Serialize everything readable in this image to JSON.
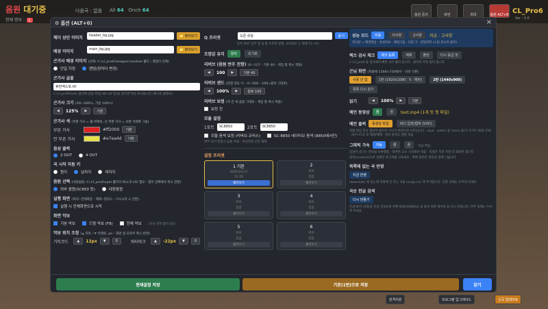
{
  "topbar": {
    "song_prefix": "음원",
    "song_suffix": "대기중",
    "flat_label": "다음곡 : 없음",
    "all_label": "All",
    "all_count": "64",
    "onch_label": "Onch",
    "onch_count": "64",
    "row2_label": "현재 명보 :",
    "row2_badge": "L",
    "btn1": "음원 중지",
    "btn2": "화면 CTRL+L",
    "btn3": "최대 CTRL+B",
    "btn4": "음원 ALT+B",
    "brand": "CL_Pro6",
    "version": "Ver : 0.6"
  },
  "dialog": {
    "title": "⚙ 옵션 (ALT+0)",
    "close": "×"
  },
  "col1": {
    "header_img_label": "헤더 상단 이미지",
    "header_img_value": "header_bg.jpg",
    "browse": "📁 찾아보기",
    "bg_img_label": "배경 이미지",
    "bg_img_value": "main_bg.jpg",
    "lyrics_bg_label": "곤가사 배경 이미지",
    "lyrics_bg_sub": "(선택: C:\\cl_pro6\\images\\random 폴더 : 랜덤이 안돼)",
    "radio_single": "단일 지정",
    "radio_random": "랜덤(장마다 변경)",
    "font_label": "곤가사 글꼴",
    "font_value": "휴먼엑스포.ttf",
    "font_sub": "C:\\cl_pro6\\fonts 폴더에 글꼴 파일(.ttf/.otf 등)을 넣으면 자동 표시됩니다 (재시작 불필요)",
    "size_label": "곤가사 크기",
    "size_sub": "(50~300%, 기본 100%)",
    "size_value": "125%",
    "default": "기본",
    "color_label": "곤가사 색",
    "color_sub": "(부른 가사 = 줄 위쪽비, 안 부른 가사 = 오른 아래쪽 그음)",
    "sung_label": "부른 가사",
    "sung_hex": "#ff2000",
    "sung_color": "#e02020",
    "unsung_label": "안 부른 가사",
    "unsung_hex": "#e7ea4d",
    "unsung_color": "#e7e04d",
    "audio_label": "음성 출력",
    "out2": "2 OUT",
    "out4": "4 OUT",
    "voice_label": "곡 시작 자동 키",
    "v1": "원키",
    "v2": "남자키",
    "v3": "여자키",
    "sound_label": "음원 선택",
    "sound_sub": "(내장음원: C:\\cl_pro6\\sym 폴더의 DLL과 sf2 필요 · 합미 선택에서 즉시 전환)",
    "s1": "외부 음원(SC850 등)",
    "s2": "내장음원",
    "exec_label": "실행 화면",
    "exec_sub": "(최대~전체화면 · 해제~창모드 · 다시시작 시 전환)",
    "exec_chk": "실행 시 전체화면으로 시작",
    "scr_label": "화면 악보",
    "scr1": "기본 악보",
    "scr2": "드럼 악보 (F8)",
    "scr3": "전체 악보",
    "scr3_sub": "(가사 영역 없이 4단)",
    "offset_label": "악보 위치 조정",
    "offset_sub": "(▲ 위로 / ▼ 아래로, px · 화면 원 오로부 즉시 반영)",
    "guitar_label": "기타코드",
    "guitar_val": "12px",
    "guitar_reset": "0",
    "water_label": "워터마크",
    "water_val": "-22px",
    "water_reset": "0"
  },
  "col2": {
    "q_label": "Q 프리셋",
    "q_value": "오픈 쉬웠",
    "q_btn": "듣기",
    "q_sub": "동주 OVT 옷무 중 Q 를 누르면 실행. A/S/D/F 는 발매 F1~F4",
    "mic_label": "조명감 유지",
    "mic_on": "유지",
    "mic_off": "초기화",
    "reverb_label": "리버브 (음원 반주 잔향)",
    "reverb_sub": "(0~127 · 기본 40 · 게임 중 즉시 적용)",
    "reverb_val": "100",
    "reverb_def": "기본 40",
    "send_label": "리버브 센드",
    "send_sub": "(잔향 강도 % · 0~200 · 100=원로 그대로)",
    "send_val": "100%",
    "send_def": "원로 100",
    "boost_label": "리버브 보정",
    "boost_sub": "(하 전 세 음원 그대로 · 게임 중 즉시 적용)",
    "boost_chk": "보정 전",
    "module_label": "모듈 설정",
    "port1": "1포트",
    "port1_val": "SC8850",
    "port2": "2포트",
    "port2_val": "SC8850",
    "mod_chk1": "모듈 음색 보정 (리버브·코러스)",
    "mod_chk2": "SC-8850 네이티브 음색 (8850에서만)",
    "mod_sub": "외부 악기 연결시 음원 특화 · 이상하면 곤한 해제",
    "preset_header": "설정 프리셋",
    "presets": [
      {
        "n": "1 기본",
        "d": "2026-03-17",
        "d2": "11:28",
        "lb": "불러오기"
      },
      {
        "n": "2",
        "d": "비어",
        "d2": "있음",
        "lb": "불러오기"
      },
      {
        "n": "3",
        "d": "비어",
        "d2": "있음",
        "lb": "불러오기"
      },
      {
        "n": "4",
        "d": "비어",
        "d2": "있음",
        "lb": "불러오기"
      },
      {
        "n": "5",
        "d": "비어",
        "d2": "있음",
        "lb": "불러오기"
      },
      {
        "n": "6",
        "d": "비어",
        "d2": "있음",
        "lb": "불러오기"
      }
    ]
  },
  "col3": {
    "perf_label": "성능 모드",
    "perf_opts": [
      "자동",
      "저사양",
      "고사양"
    ],
    "perf_cur": "지금 : 고사양",
    "perf_sub": "저사양 = 배경영상 · 손실악보 · 배점그림 · 인원 그 · 잔업까지 (스킵 콘소리 없이)",
    "album_label": "렉쓰 검사 체크",
    "album_opts": [
      "체크 등록",
      "예제",
      "폴린",
      "다시 등급 첫"
    ],
    "album_sub": "C:\\cl_pro6 을 검사해서 빠른 곡이 몰리 입니다 · 원리적 목적 없이 됩니다",
    "res_label": "곤님 화면",
    "res_sub": "(적용에 1280×720에서 · 이웃 다른)",
    "res_opts": [
      "사용 안 함",
      "1번 (1920x1080 · 5 · 해된)",
      "2번 (1440x900)"
    ],
    "res_reset": "목록 다시 읽기",
    "read_label": "읽기",
    "read_val": "100%",
    "read_def": "기본",
    "v_label": "예언 동영상",
    "v_opts": [
      "켬",
      "끔"
    ],
    "v_file": "text.mp4 (1개 등 첫 파일)",
    "p_label": "예언 출력",
    "p_opts": [
      "동영상 파일",
      "비디 입력/캡쳐 (VVD)"
    ],
    "p_sub": "직렬 영상 장시 영상이 없으면 기사가 변경으로 나타납니다 . mp4 · webm 등 (venv 줄기) 이 PC 60원 (F8) · ALT+F12 로 재생/해제 · 원라 충족도 영향 적음",
    "g_label": "그래픽 가속",
    "g_opts": [
      "자동",
      "켬",
      "끔",
      "지금 켜짐"
    ],
    "g_sub": "장날이 끊기는 현의실 보류행됨 · 화면면 고시 시작해서 적용 · 직원은 지원 지원 다 돼야만 합니다",
    "g_sub2": "화약(renderd)으로 실행한 로그까를 고루세요 · 확백 화면은 변진과 함께 나뉩니다",
    "list_label": "목록에 없는 곡 반영",
    "list_btn": "지금 반영",
    "list_sub": "(www.kak) 에 있는데 목록에 안 뜨는 곡을 songs.csv 에 추가합니다. 전후 곡예는 누르지 마세요",
    "search_label": "곡순 한글 검색",
    "search_btn": "다시 만들기",
    "search_sub": "한글(로마 검색)을 진실 건실으로 변환 바람(HANGUL 을 돌려 경로 세우로 들 다시 만들니다. 연주 중에는 누르지 마세요"
  },
  "footer": {
    "save": "현재설정 저장",
    "def_save": "기본(1번)으로 저장",
    "close": "닫기"
  },
  "bottom": {
    "b1": "원격지원",
    "b2": "프로그램 업그레이드",
    "b3": "신곡 업데이트"
  }
}
